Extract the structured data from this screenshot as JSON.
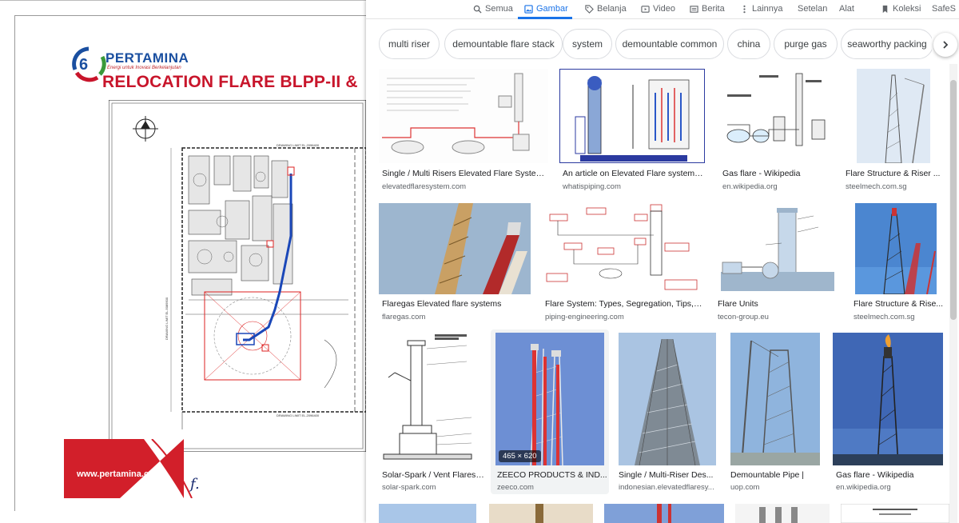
{
  "document": {
    "brand": "PERTAMINA",
    "tagline": "Energi untuk Inovasi Berkelanjutan",
    "title": "RELOCATION FLARE BLPP-II &",
    "website": "www.pertamina.com",
    "signature": "f.",
    "drawing_label_top": "DRAWING LIMIT EL.2096400",
    "drawing_label_bottom": "DRAWING LIMIT EL.2096400",
    "drawing_label_side": "DRAWING LIMIT EL.5089500"
  },
  "nav": {
    "items": [
      {
        "label": "Semua",
        "icon": "search-icon"
      },
      {
        "label": "Gambar",
        "icon": "image-icon"
      },
      {
        "label": "Belanja",
        "icon": "tag-icon"
      },
      {
        "label": "Video",
        "icon": "video-icon"
      },
      {
        "label": "Berita",
        "icon": "newspaper-icon"
      },
      {
        "label": "Lainnya",
        "icon": "more-vertical-icon"
      },
      {
        "label": "Setelan",
        "icon": ""
      },
      {
        "label": "Alat",
        "icon": ""
      },
      {
        "label": "Koleksi",
        "icon": "bookmark-icon"
      },
      {
        "label": "SafeS",
        "icon": ""
      }
    ],
    "active": "Gambar"
  },
  "chips": [
    "multi riser",
    "demountable flare stack",
    "system",
    "demountable common",
    "china",
    "purge gas",
    "seaworthy packing"
  ],
  "results": [
    {
      "caption": "Single / Multi Risers Elevated Flare System ...",
      "source": "elevatedflaresystem.com",
      "art": "diagram-process"
    },
    {
      "caption": "An article on Elevated Flare systems: ...",
      "source": "whatispiping.com",
      "art": "diagram-blue"
    },
    {
      "caption": "Gas flare - Wikipedia",
      "source": "en.wikipedia.org",
      "art": "diagram-bw"
    },
    {
      "caption": "Flare Structure & Riser ...",
      "source": "steelmech.com.sg",
      "art": "tower-sky"
    },
    {
      "caption": "Flaregas Elevated flare systems",
      "source": "flaregas.com",
      "art": "tower-up"
    },
    {
      "caption": "Flare System: Types, Segregation, Tips, P...",
      "source": "piping-engineering.com",
      "art": "diagram-red"
    },
    {
      "caption": "Flare Units",
      "source": "tecon-group.eu",
      "art": "diagram-units"
    },
    {
      "caption": "Flare Structure & Rise...",
      "source": "steelmech.com.sg",
      "art": "tower-blue"
    },
    {
      "caption": "Solar-Spark / Vent Flares ...",
      "source": "solar-spark.com",
      "art": "diagram-vent"
    },
    {
      "caption": "ZEECO PRODUCTS & IND...",
      "source": "zeeco.com",
      "art": "tower-stack",
      "badge": "465 × 620"
    },
    {
      "caption": "Single / Multi-Riser Des...",
      "source": "indonesian.elevatedflaresy...",
      "art": "tower-derrick"
    },
    {
      "caption": "Demountable Pipe |",
      "source": "uop.com",
      "art": "tower-crane"
    },
    {
      "caption": "Gas flare - Wikipedia",
      "source": "en.wikipedia.org",
      "art": "tower-dusk"
    }
  ],
  "colors": {
    "accent": "#1a73e8",
    "brand_red": "#c8152b",
    "brand_blue": "#1a4fa0",
    "sky_blue": "#6f9fd8"
  }
}
